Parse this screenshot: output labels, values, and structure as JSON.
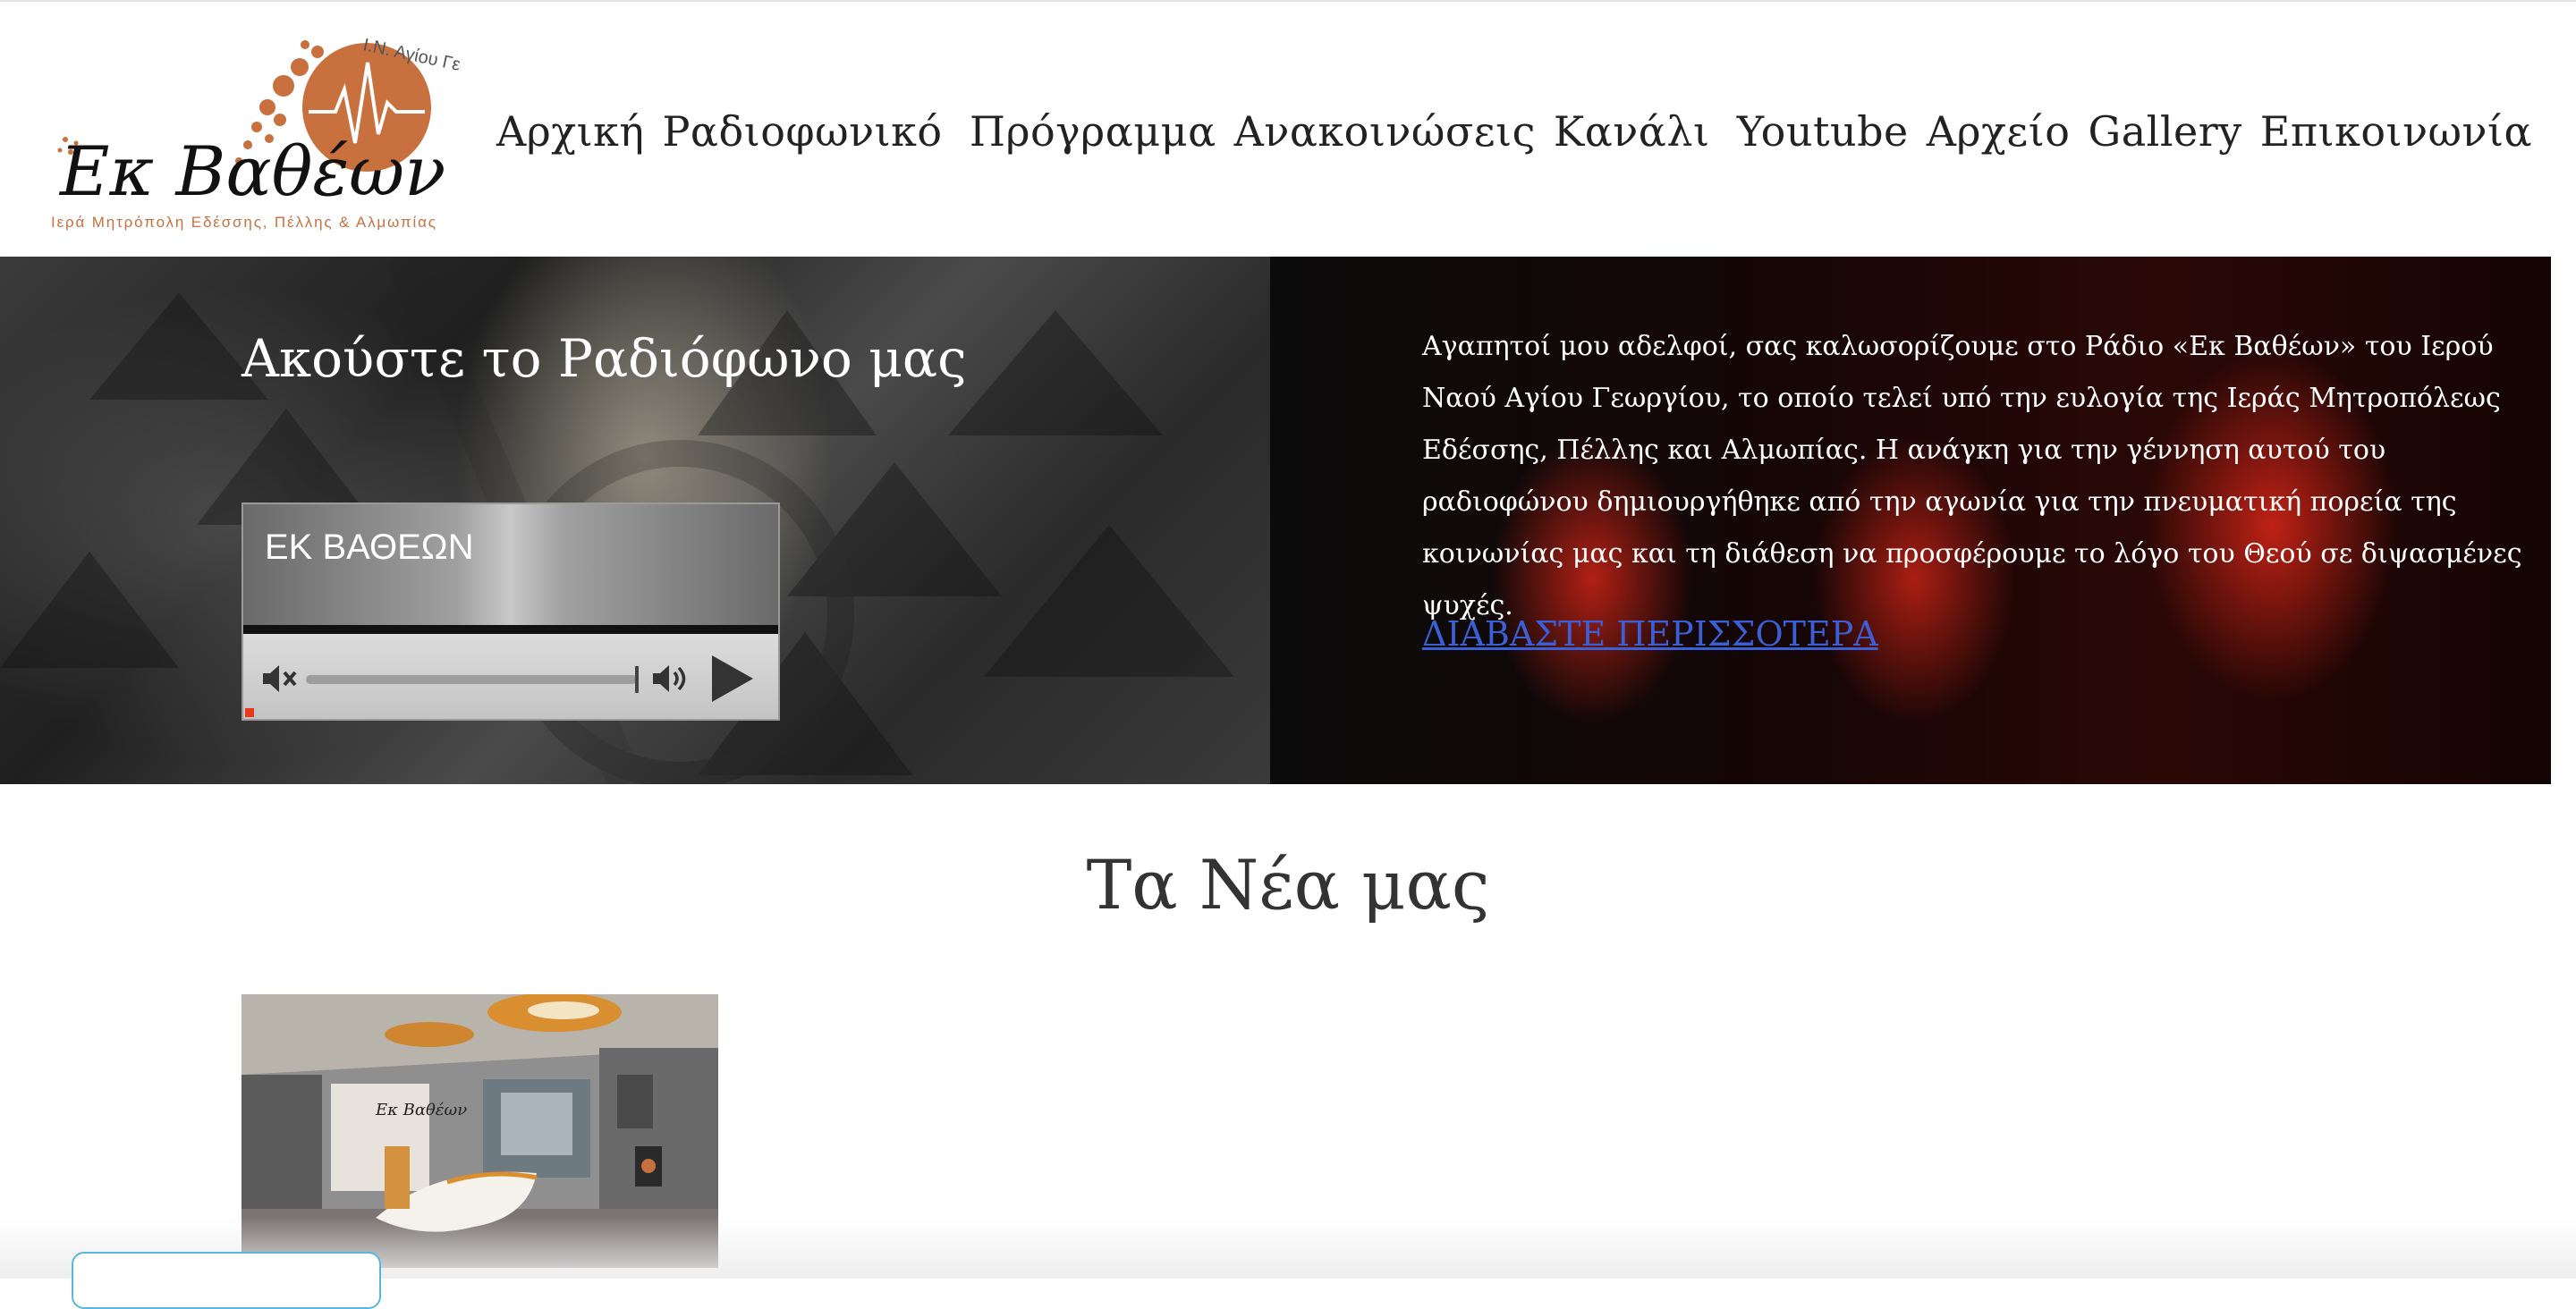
{
  "logo": {
    "top_arc_text": "Ι.Ν. Αγίου Γεωργίου",
    "brand": "Εκ Βαθέων",
    "subtitle": "Ιερά Μητρόπολη Εδέσσης, Πέλλης & Αλμωπίας",
    "accent_color": "#c8703e"
  },
  "nav": {
    "items": [
      "Αρχική",
      "Ραδιοφωνικό  Πρόγραμμα",
      "Ανακοινώσεις",
      "Κανάλι  Youtube",
      "Αρχείο",
      "Gallery",
      "Επικοινωνία"
    ]
  },
  "hero": {
    "title": "Ακούστε το Ραδιόφωνο μας",
    "player": {
      "station_name": "ΕΚ ΒΑΘΕΩΝ",
      "mute_icon": "speaker-mute-icon",
      "volume_icon": "speaker-volume-icon",
      "play_icon": "play-icon"
    },
    "paragraph": "Αγαπητοί μου αδελφοί, σας καλωσορίζουμε στο Ράδιο «Εκ Βαθέων» του Ιερού Ναού Αγίου Γεωργίου, το οποίο τελεί υπό την ευλογία της Ιεράς Μητροπόλεως Εδέσσης, Πέλλης και Αλμωπίας. Η ανάγκη για την γέννηση αυτού του ραδιοφώνου δημιουργήθηκε από την αγωνία για την πνευματική πορεία της κοινωνίας μας και τη διάθεση να προσφέρουμε το λόγο του Θεού σε διψασμένες ψυχές.",
    "read_more": "ΔΙΑΒΑΣΤΕ ΠΕΡΙΣΣΟΤΕΡΑ",
    "link_color": "#3b5fd6"
  },
  "news": {
    "title": "Τα Νέα μας"
  }
}
